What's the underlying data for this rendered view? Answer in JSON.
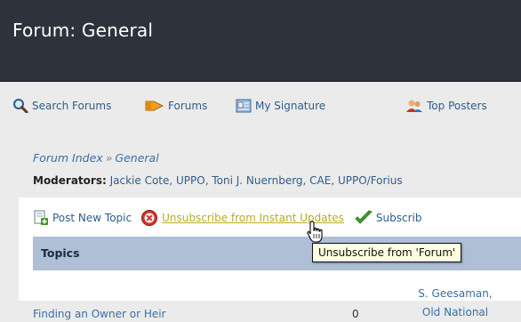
{
  "page": {
    "title": "Forum: General"
  },
  "nav": {
    "items": [
      {
        "label": "Search Forums",
        "icon": "search-icon"
      },
      {
        "label": "Forums",
        "icon": "forums-icon"
      },
      {
        "label": "My Signature",
        "icon": "signature-icon"
      },
      {
        "label": "Top Posters",
        "icon": "top-posters-icon"
      }
    ]
  },
  "breadcrumb": {
    "root": "Forum Index",
    "separator": "»",
    "current": "General"
  },
  "moderators": {
    "label": "Moderators:",
    "names": "Jackie Cote, UPPO, Toni J. Nuernberg, CAE, UPPO/Forius"
  },
  "actions": {
    "post_new_topic": "Post New Topic",
    "unsubscribe": "Unsubscribe from Instant Updates",
    "subscribe": "Subscrib"
  },
  "table": {
    "header": "Topics",
    "rows": [
      {
        "topic": "Finding an Owner or Heir",
        "count": "0",
        "last_post_line1": "S. Geesaman,",
        "last_post_line2": "Old National"
      }
    ]
  },
  "tooltip": {
    "text": "Unsubscribe from 'Forum'"
  },
  "colors": {
    "titlebar": "#2e323a",
    "link": "#2f5d8a",
    "header_row": "#aebfd6",
    "hover_link": "#b4ad2a"
  }
}
